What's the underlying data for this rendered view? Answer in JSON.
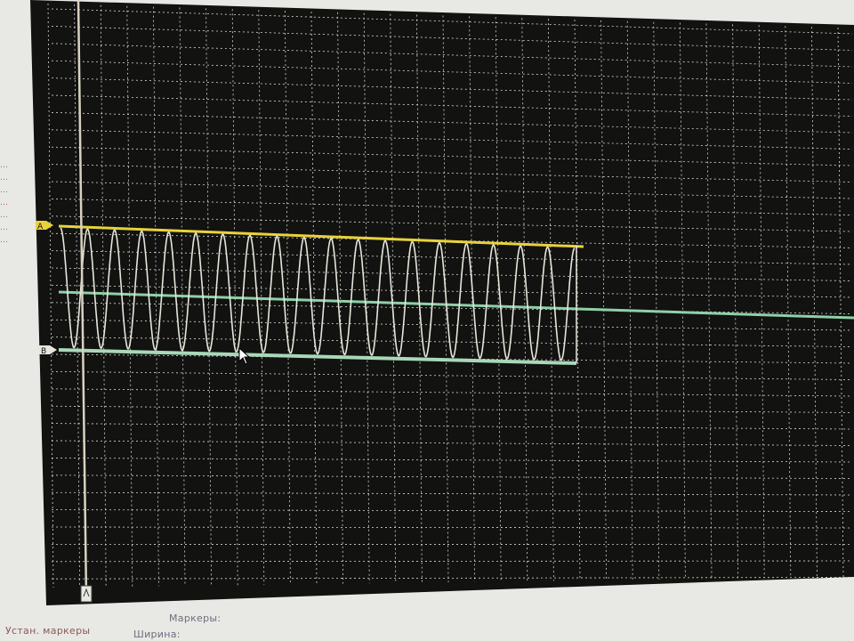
{
  "window": {
    "title": ""
  },
  "scope": {
    "grid_visible": true,
    "background_color": "#0f0f0e",
    "grid_color": "#d8d8d8",
    "marker_a": {
      "label": "A",
      "color": "#e8d23a"
    },
    "marker_b": {
      "label": "B",
      "color": "#a8d8b8"
    },
    "trace": {
      "color": "#e6e6da",
      "cycles": 19
    },
    "center_line_color": "#8fd0a8",
    "time_cursor_color": "#d8d2c0"
  },
  "bottom_bar": {
    "set_markers_label": "Устан. маркеры",
    "markers_label": "Маркеры:",
    "width_label": "Ширина:"
  },
  "left_panel": {
    "side_marks": [
      "…",
      "…",
      "…",
      "…",
      "…",
      "…",
      "…"
    ]
  }
}
